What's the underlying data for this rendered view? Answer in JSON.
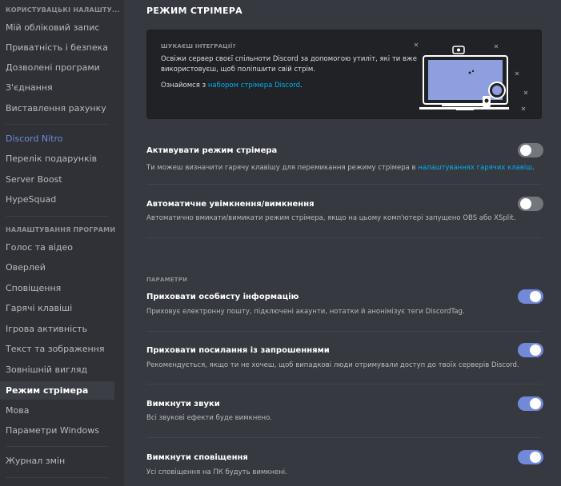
{
  "colors": {
    "accent": "#7289da",
    "link": "#00b0f4",
    "toggle_off": "#72767d"
  },
  "sidebar": {
    "user_settings_header": "КОРИСТУВАЦЬКІ НАЛАШТУ...",
    "user_items": [
      "Мій обліковий запис",
      "Приватність і безпека",
      "Дозволені програми",
      "З'єднання",
      "Виставлення рахунку"
    ],
    "nitro_items": [
      "Discord Nitro",
      "Перелік подарунків",
      "Server Boost",
      "HypeSquad"
    ],
    "app_settings_header": "НАЛАШТУВАННЯ ПРОГРАМИ",
    "app_items": [
      "Голос та відео",
      "Оверлей",
      "Сповіщення",
      "Гарячі клавіші",
      "Ігрова активність",
      "Текст та зображення",
      "Зовнішній вигляд",
      "Режим стрімера",
      "Мова",
      "Параметри Windows"
    ],
    "changelog": "Журнал змін"
  },
  "main": {
    "title": "РЕЖИМ СТРІМЕРА",
    "promo": {
      "kicker": "ШУКАЄШ ІНТЕГРАЦІЇ?",
      "text": "Освіжи сервер своєї спільноти Discord за допомогою утиліт, які ти вже використовуєш, щоб поліпшити свій стрім.",
      "link_prefix": "Ознайомся з ",
      "link_text": "набором стрімера Discord",
      "link_suffix": "."
    },
    "options": [
      {
        "title": "Активувати режим стрімера",
        "desc_prefix": "Ти можеш визначити гарячу клавішу для перемикання режиму стрімера в ",
        "desc_link": "налаштуваннях гарячих клавіш",
        "desc_suffix": ".",
        "on": false
      },
      {
        "title": "Автоматичне увімкнення/вимкнення",
        "desc": "Автоматично вмикати/вимикати режим стрімера, якщо на цьому комп'ютері запущено OBS або XSplit.",
        "on": false
      }
    ],
    "section_label": "ПАРАМЕТРИ",
    "params": [
      {
        "title": "Приховати особисту інформацію",
        "desc": "Приховує електронну пошту, підключені акаунти, нотатки й анонімізує теги DiscordTag.",
        "on": true
      },
      {
        "title": "Приховати посилання із запрошеннями",
        "desc": "Рекомендується, якщо ти не хочеш, щоб випадкові люди отримували доступ до твоїх серверів Discord.",
        "on": true
      },
      {
        "title": "Вимкнути звуки",
        "desc": "Всі звукові ефекти буде вимкнено.",
        "on": true
      },
      {
        "title": "Вимкнути сповіщення",
        "desc": "Усі сповіщення на ПК будуть вимкнені.",
        "on": true
      }
    ]
  }
}
